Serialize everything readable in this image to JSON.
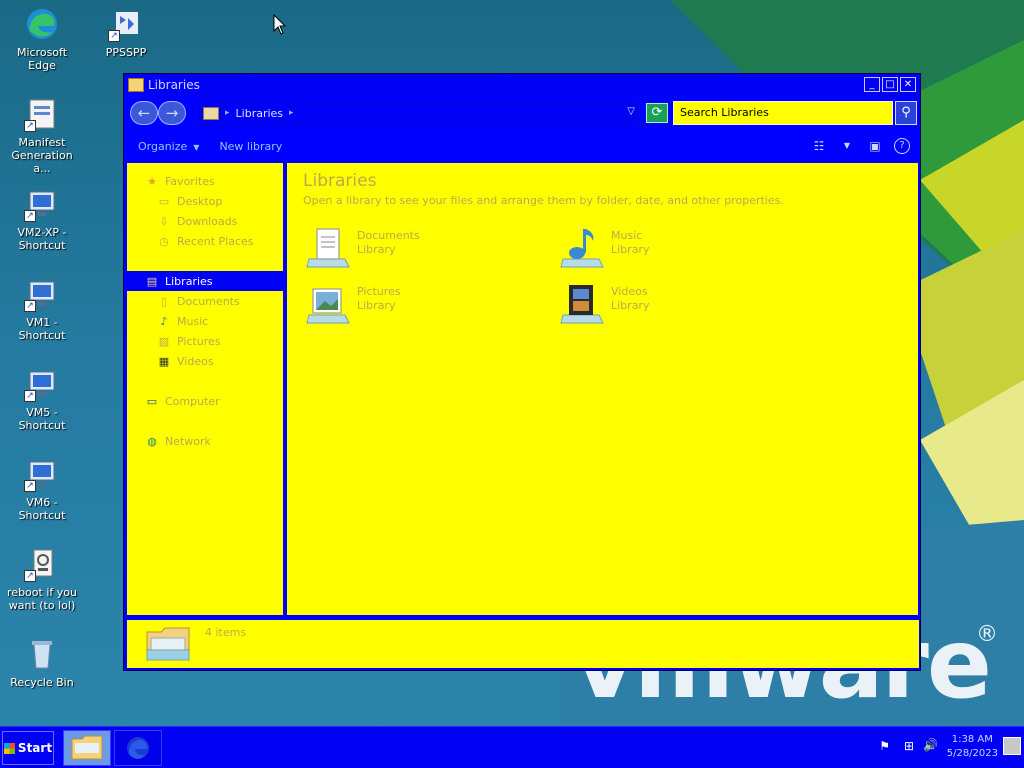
{
  "desktop": {
    "icons": [
      {
        "label": "Microsoft Edge"
      },
      {
        "label": "PPSSPP"
      },
      {
        "label": "Manifest Generation a..."
      },
      {
        "label": "VM2-XP - Shortcut"
      },
      {
        "label": "VM1 - Shortcut"
      },
      {
        "label": "VM5 - Shortcut"
      },
      {
        "label": "VM6 - Shortcut"
      },
      {
        "label": "reboot if you want (to lol)"
      },
      {
        "label": "Recycle Bin"
      }
    ],
    "wallpaper_logo": "vmware",
    "wallpaper_reg": "®"
  },
  "window": {
    "title": "Libraries",
    "address": {
      "crumb": "Libraries"
    },
    "search": {
      "value": "Search Libraries"
    },
    "commands": {
      "organize": "Organize",
      "new_library": "New library"
    },
    "nav": {
      "favorites": "Favorites",
      "desktop": "Desktop",
      "downloads": "Downloads",
      "recent_places": "Recent Places",
      "libraries": "Libraries",
      "documents": "Documents",
      "music": "Music",
      "pictures": "Pictures",
      "videos": "Videos",
      "computer": "Computer",
      "network": "Network"
    },
    "content": {
      "heading": "Libraries",
      "subtitle": "Open a library to see your files and arrange them by folder, date, and other properties.",
      "items": [
        {
          "name": "Documents",
          "type": "Library"
        },
        {
          "name": "Music",
          "type": "Library"
        },
        {
          "name": "Pictures",
          "type": "Library"
        },
        {
          "name": "Videos",
          "type": "Library"
        }
      ]
    },
    "details": {
      "count": "4 items"
    }
  },
  "taskbar": {
    "start_label": "Start",
    "time": "1:38 AM",
    "date": "5/28/2023"
  },
  "colors": {
    "window_chrome": "#0000ff",
    "pane_background": "#ffff00",
    "faded_text": "#b8ac4a",
    "selection": "#0000f5"
  }
}
